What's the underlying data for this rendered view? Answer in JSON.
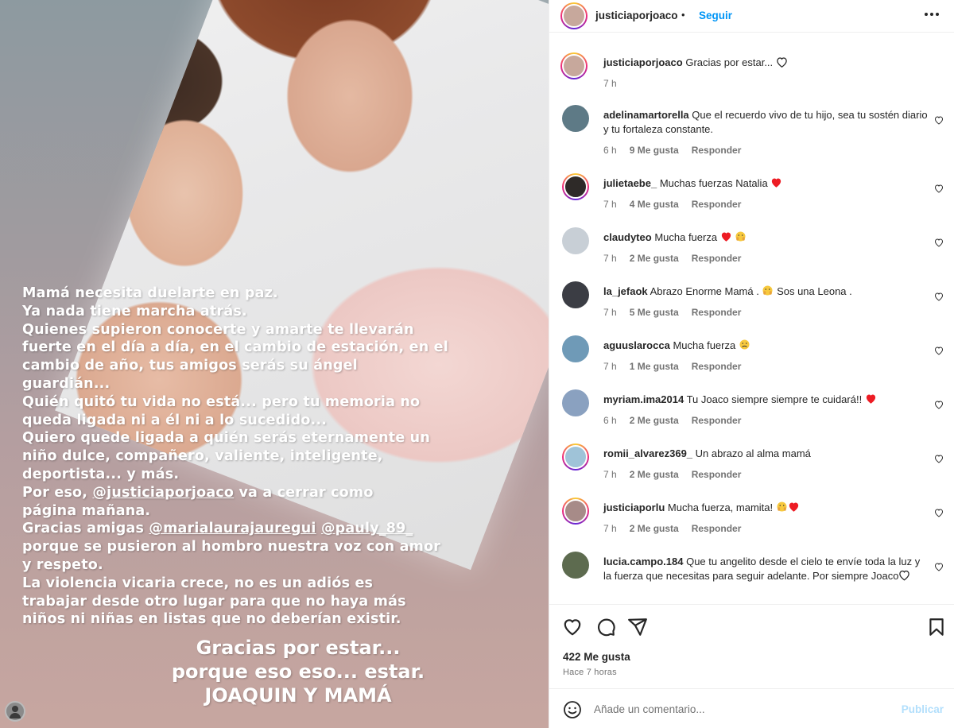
{
  "story": {
    "text_lines": [
      "Mamá necesita duelarte en paz.",
      "Ya nada tiene marcha atrás.",
      "Quienes supieron conocerte y amarte te llevarán",
      "fuerte en el día a día, en el cambio de estación, en el",
      "cambio de año, tus amigos serás su ángel",
      "guardián...",
      "Quién quitó tu vida no está... pero tu memoria no",
      "queda ligada ni a él ni a lo sucedido...",
      "Quiero quede ligada a quién serás eternamente un",
      "niño dulce, compañero, valiente, inteligente,",
      "deportista... y más."
    ],
    "line_por_eso_pre": "Por eso, ",
    "mention_1": "@justiciaporjoaco",
    "line_por_eso_post": " va a cerrar como",
    "line_pagina": "página mañana.",
    "line_gracias_pre": "Gracias amigas ",
    "mention_2": "@marialaurajauregui",
    "mention_3": "@pauly_89_",
    "text_lines_2": [
      "porque se pusieron al hombro nuestra voz con amor",
      "y respeto.",
      "La violencia vicaria crece, no es un adiós es",
      "trabajar desde otro lugar para que no haya más",
      "niños ni niñas en listas que no deberían existir."
    ],
    "closing_1": "Gracias por estar...",
    "closing_2": "porque eso eso... estar.",
    "closing_3": "JOAQUIN Y MAMÁ"
  },
  "header": {
    "username": "justiciaporjoaco",
    "dot": "•",
    "follow_label": "Seguir"
  },
  "caption": {
    "username": "justiciaporjoaco",
    "text": "Gracias por estar... ",
    "time": "7 h"
  },
  "comments": [
    {
      "user": "adelinamartorella",
      "text": "Que el recuerdo vivo de tu hijo, sea tu sostén diario y tu fortaleza constante.",
      "time": "6 h",
      "likes": "9 Me gusta",
      "reply": "Responder",
      "avatar_color": "#5e7a86"
    },
    {
      "user": "julietaebe_",
      "text": "Muchas fuerzas Natalia ",
      "time": "7 h",
      "likes": "4 Me gusta",
      "reply": "Responder",
      "avatar_color": "#2e2a28"
    },
    {
      "user": "claudyteo",
      "text": "Mucha fuerza ",
      "time": "7 h",
      "likes": "2 Me gusta",
      "reply": "Responder",
      "avatar_color": "#c8cfd6"
    },
    {
      "user": "la_jefaok",
      "text": "Abrazo Enorme Mamá . ",
      "text2": " Sos una Leona .",
      "time": "7 h",
      "likes": "5 Me gusta",
      "reply": "Responder",
      "avatar_color": "#3b3d44"
    },
    {
      "user": "aguuslarocca",
      "text": "Mucha fuerza ",
      "time": "7 h",
      "likes": "1 Me gusta",
      "reply": "Responder",
      "avatar_color": "#6f9ab7"
    },
    {
      "user": "myriam.ima2014",
      "text": "Tu Joaco siempre siempre te cuidará!! ",
      "time": "6 h",
      "likes": "2 Me gusta",
      "reply": "Responder",
      "avatar_color": "#8aa1c0"
    },
    {
      "user": "romii_alvarez369_",
      "text": "Un abrazo al alma mamá",
      "time": "7 h",
      "likes": "2 Me gusta",
      "reply": "Responder",
      "avatar_color": "#9fc3d8"
    },
    {
      "user": "justiciaporlu",
      "text": "Mucha fuerza, mamita! ",
      "time": "7 h",
      "likes": "2 Me gusta",
      "reply": "Responder",
      "avatar_color": "#a78b88"
    },
    {
      "user": "lucia.campo.184",
      "text": "Que tu angelito desde el cielo te envíe toda la luz y la fuerza que necesitas para seguir adelante. Por siempre Joaco",
      "time": "",
      "likes": "",
      "reply": "",
      "avatar_color": "#5d6b4f"
    }
  ],
  "likes_count": "422 Me gusta",
  "posted_time": "Hace 7 horas",
  "add_comment": {
    "placeholder": "Añade un comentario...",
    "publish_label": "Publicar"
  },
  "colors": {
    "accent": "#0095f6",
    "publish_disabled": "#b2dffc",
    "like_red": "#ed1c24",
    "meta_gray": "#737373"
  },
  "icons": [
    "heart-icon",
    "comment-icon",
    "share-icon",
    "bookmark-icon",
    "emoji-icon",
    "more-icon"
  ]
}
